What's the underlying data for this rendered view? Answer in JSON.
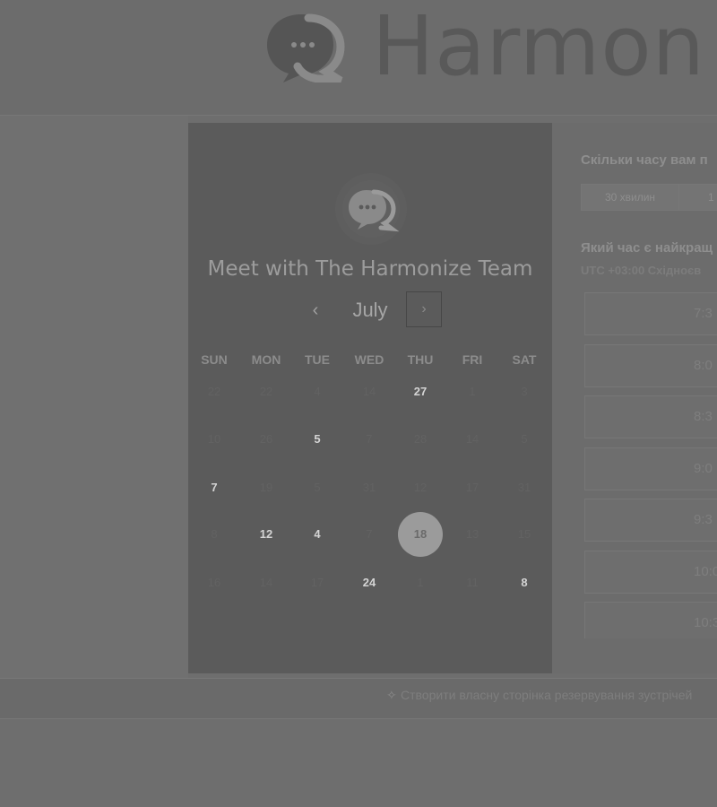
{
  "header": {
    "brand_text": "Harmon",
    "logo_icon": "chat-bubble-q-logo"
  },
  "card": {
    "title": "Meet with The Harmonize Team",
    "month": "July",
    "prev_label": "‹",
    "next_label": "›",
    "weekdays": [
      "SUN",
      "MON",
      "TUE",
      "WED",
      "THU",
      "FRI",
      "SAT"
    ],
    "days": [
      [
        {
          "t": "22",
          "s": "disabled"
        },
        {
          "t": "22",
          "s": "disabled"
        },
        {
          "t": "4",
          "s": "disabled"
        },
        {
          "t": "14",
          "s": "disabled"
        },
        {
          "t": "27",
          "s": "available"
        },
        {
          "t": "1",
          "s": "disabled"
        },
        {
          "t": "3",
          "s": "disabled"
        }
      ],
      [
        {
          "t": "10",
          "s": "disabled"
        },
        {
          "t": "26",
          "s": "disabled"
        },
        {
          "t": "5",
          "s": "available"
        },
        {
          "t": "7",
          "s": "disabled"
        },
        {
          "t": "28",
          "s": "disabled"
        },
        {
          "t": "14",
          "s": "disabled"
        },
        {
          "t": "5",
          "s": "disabled"
        }
      ],
      [
        {
          "t": "7",
          "s": "available"
        },
        {
          "t": "19",
          "s": "disabled"
        },
        {
          "t": "5",
          "s": "disabled"
        },
        {
          "t": "31",
          "s": "disabled"
        },
        {
          "t": "12",
          "s": "disabled"
        },
        {
          "t": "17",
          "s": "disabled"
        },
        {
          "t": "31",
          "s": "disabled"
        }
      ],
      [
        {
          "t": "8",
          "s": "disabled"
        },
        {
          "t": "12",
          "s": "available"
        },
        {
          "t": "4",
          "s": "available"
        },
        {
          "t": "7",
          "s": "disabled"
        },
        {
          "t": "18",
          "s": "selected"
        },
        {
          "t": "13",
          "s": "disabled"
        },
        {
          "t": "15",
          "s": "disabled"
        }
      ],
      [
        {
          "t": "16",
          "s": "disabled"
        },
        {
          "t": "14",
          "s": "disabled"
        },
        {
          "t": "17",
          "s": "disabled"
        },
        {
          "t": "24",
          "s": "available"
        },
        {
          "t": "1",
          "s": "disabled"
        },
        {
          "t": "11",
          "s": "disabled"
        },
        {
          "t": "8",
          "s": "available"
        }
      ]
    ]
  },
  "right": {
    "duration_question": "Скільки часу вам п",
    "duration_tabs": [
      "30 хвилин",
      "1"
    ],
    "time_question": "Який час є найкращ",
    "timezone": "UTC +03:00 Східноєв",
    "slots": [
      "7:3",
      "8:0",
      "8:3",
      "9:0",
      "9:3",
      "10:0",
      "10:3"
    ]
  },
  "footer": {
    "link_text": "Створити власну сторінка резервування зустрічей",
    "link_icon": "wand-icon"
  }
}
